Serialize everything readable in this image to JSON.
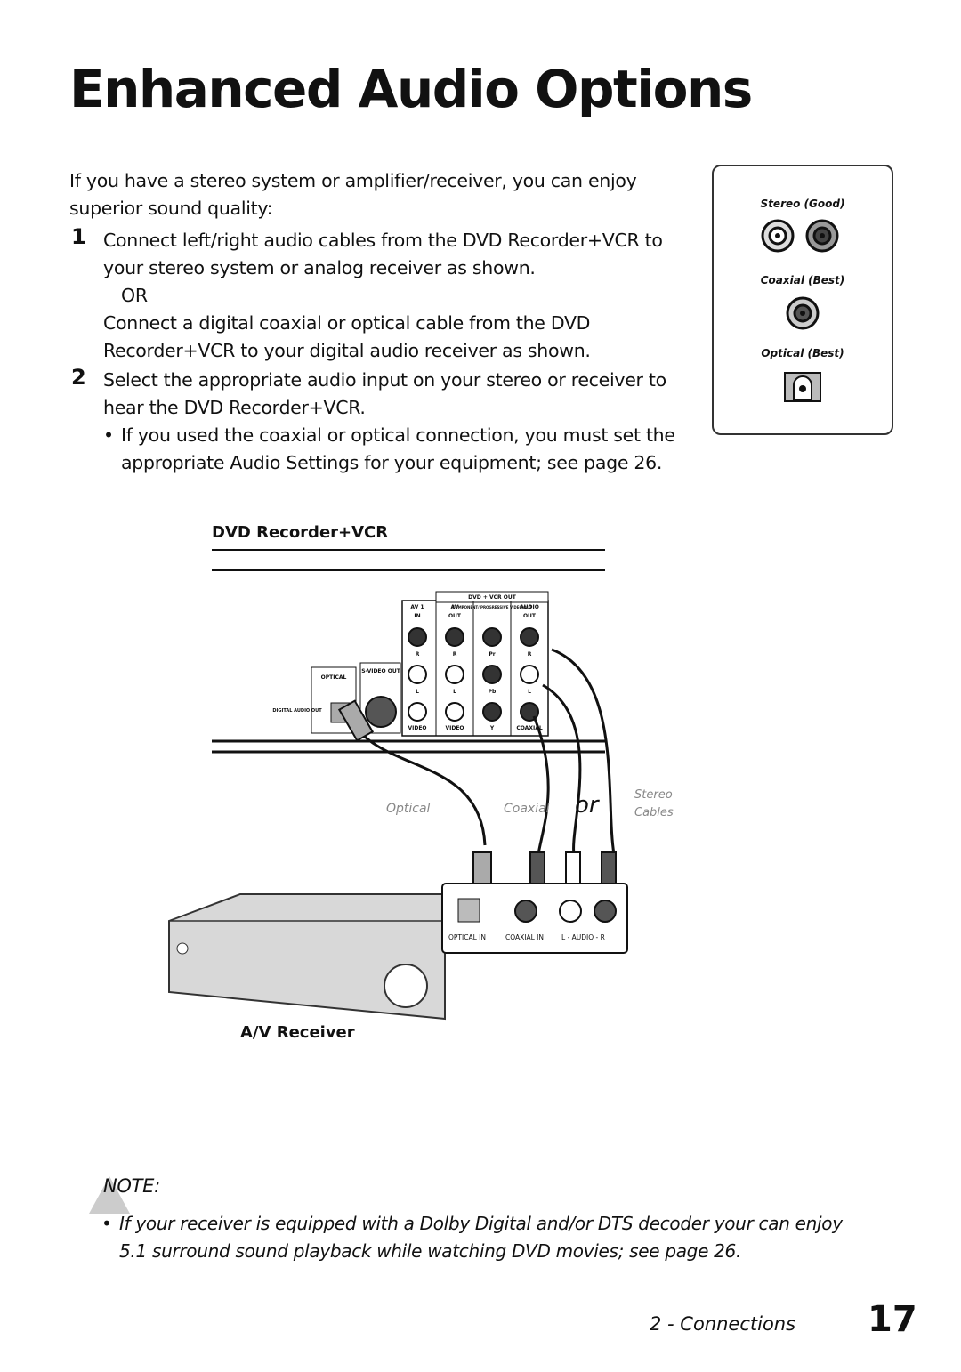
{
  "title": "Enhanced Audio Options",
  "intro": [
    "If you have a stereo system or amplifier/receiver, you can enjoy",
    "superior sound quality:"
  ],
  "steps": [
    {
      "number": "1",
      "lines": [
        "Connect left/right audio cables from the DVD Recorder+VCR to",
        "your stereo system or analog receiver as shown."
      ],
      "or": "OR",
      "lines2": [
        "Connect a digital coaxial or optical cable from the DVD",
        "Recorder+VCR to your digital audio receiver as shown."
      ]
    },
    {
      "number": "2",
      "lines": [
        "Select the appropriate audio input on your stereo or receiver to",
        "hear the DVD Recorder+VCR."
      ],
      "bullet": [
        "If you used the coaxial or optical connection, you must set the",
        "appropriate Audio Settings for your equipment; see page 26."
      ]
    }
  ],
  "legend_box": {
    "stereo": "Stereo (Good)",
    "coaxial": "Coaxial (Best)",
    "optical": "Optical (Best)"
  },
  "diagram": {
    "device_label": "DVD Recorder+VCR",
    "receiver_label": "A/V Receiver",
    "panel": {
      "header": "DVD + VCR OUT",
      "av1": "AV 1",
      "in": "IN",
      "av": "AV",
      "out": "OUT",
      "component": "COMPONENT/ PROGRESSIVE VIDEO OUT",
      "audio": "AUDIO",
      "audio_out": "OUT",
      "optical": "OPTICAL",
      "svideo": "S-VIDEO OUT",
      "digital": "DIGITAL AUDIO OUT",
      "r": "R",
      "l": "L",
      "video": "VIDEO",
      "pr": "Pr",
      "pb": "Pb",
      "y": "Y",
      "coax": "COAXIAL"
    },
    "cables": {
      "optical": "Optical",
      "coaxial": "Coaxial",
      "or": "or",
      "stereo": "Stereo",
      "cables": "Cables"
    },
    "receiver_inputs": {
      "optical_in": "OPTICAL IN",
      "coaxial_in": "COAXIAL IN",
      "audio": "L - AUDIO - R"
    }
  },
  "note": {
    "label": "NOTE:",
    "lines": [
      "If your receiver is equipped with a Dolby Digital and/or DTS decoder your can enjoy",
      "5.1 surround sound playback while watching DVD movies; see page 26."
    ]
  },
  "footer": {
    "section": "2 - Connections",
    "page": "17"
  }
}
